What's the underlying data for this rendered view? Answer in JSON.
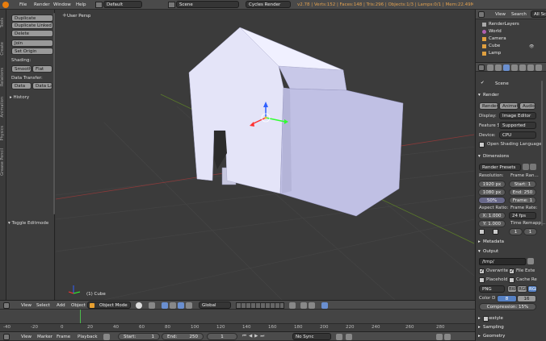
{
  "info_header": {
    "menus": [
      "File",
      "Render",
      "Window",
      "Help"
    ],
    "layout": "Default",
    "scene": "Scene",
    "engine": "Cycles Render",
    "stats": "v2.78 | Verts:152 | Faces:148 | Tris:296 | Objects:1/3 | Lamps:0/1 | Mem:22.49M | Cube"
  },
  "tool_shelf": {
    "tabs": [
      "Tools",
      "Create",
      "Relations",
      "Animation",
      "Physics",
      "Grease Pencil"
    ],
    "buttons": [
      "Duplicate",
      "Duplicate Linked",
      "Delete",
      "Join"
    ],
    "set_origin": "Set Origin",
    "shading_label": "Shading:",
    "smooth": "Smooth",
    "flat": "Flat",
    "data_transfer_label": "Data Transfer:",
    "data": "Data",
    "data_layout": "Data Lay",
    "history": "History",
    "toggle_editmode": "Toggle Editmode"
  },
  "viewport": {
    "view_label": "User Persp",
    "object_label": "(1) Cube"
  },
  "viewport_header": {
    "menus": [
      "View",
      "Select",
      "Add",
      "Object"
    ],
    "mode": "Object Mode",
    "orientation": "Global"
  },
  "timeline": {
    "menus": [
      "View",
      "Marker",
      "Frame",
      "Playback"
    ],
    "start_label": "Start:",
    "start": "1",
    "end_label": "End:",
    "end": "250",
    "current": "1",
    "sync": "No Sync",
    "ruler": [
      "-40",
      "-20",
      "0",
      "20",
      "40",
      "60",
      "80",
      "100",
      "120",
      "140",
      "160",
      "180",
      "200",
      "220",
      "240",
      "260",
      "280"
    ]
  },
  "outliner": {
    "menus": [
      "View",
      "Search"
    ],
    "filter": "All Scenes",
    "items": [
      "RenderLayers",
      "World",
      "Camera",
      "Cube",
      "Lamp"
    ]
  },
  "properties": {
    "context": "Scene",
    "render_section": "Render",
    "render_buttons": [
      "Render",
      "Animation",
      "Audio"
    ],
    "display_label": "Display:",
    "display_value": "Image Editor",
    "feature_label": "Feature Set:",
    "feature_value": "Supported",
    "device_label": "Device:",
    "device_value": "CPU",
    "osl_label": "Open Shading Language",
    "dimensions_section": "Dimensions",
    "render_presets": "Render Presets",
    "resolution_label": "Resolution:",
    "res_x": "1920 px",
    "res_y": "1080 px",
    "res_pct": "50%",
    "frame_range_label": "Frame Ran...",
    "frame_start": "Start: 1",
    "frame_end": "End: 250",
    "frame_step": "Frame: 1",
    "aspect_label": "Aspect Ratio:",
    "aspect_x": "X: 1.000",
    "aspect_y": "Y: 1.000",
    "frame_rate_label": "Frame Rate:",
    "frame_rate": "24 fps",
    "time_remap_label": "Time Remapp...",
    "remap_old": "1",
    "remap_new": "1",
    "metadata_section": "Metadata",
    "output_section": "Output",
    "output_path": "/tmp/",
    "overwrite": "Overwrite",
    "file_ext": "File Exte",
    "placeholders": "Placehold",
    "cache_result": "Cache Re",
    "format": "PNG",
    "bw": "BW",
    "rgb": "RGB",
    "rgba": "RGBA",
    "color_depth_label": "Color D",
    "depth_8": "8",
    "depth_16": "16",
    "compression": "Compression: 15%",
    "freestyle_section": "Freestyle",
    "sampling_section": "Sampling",
    "geometry_section": "Geometry"
  }
}
